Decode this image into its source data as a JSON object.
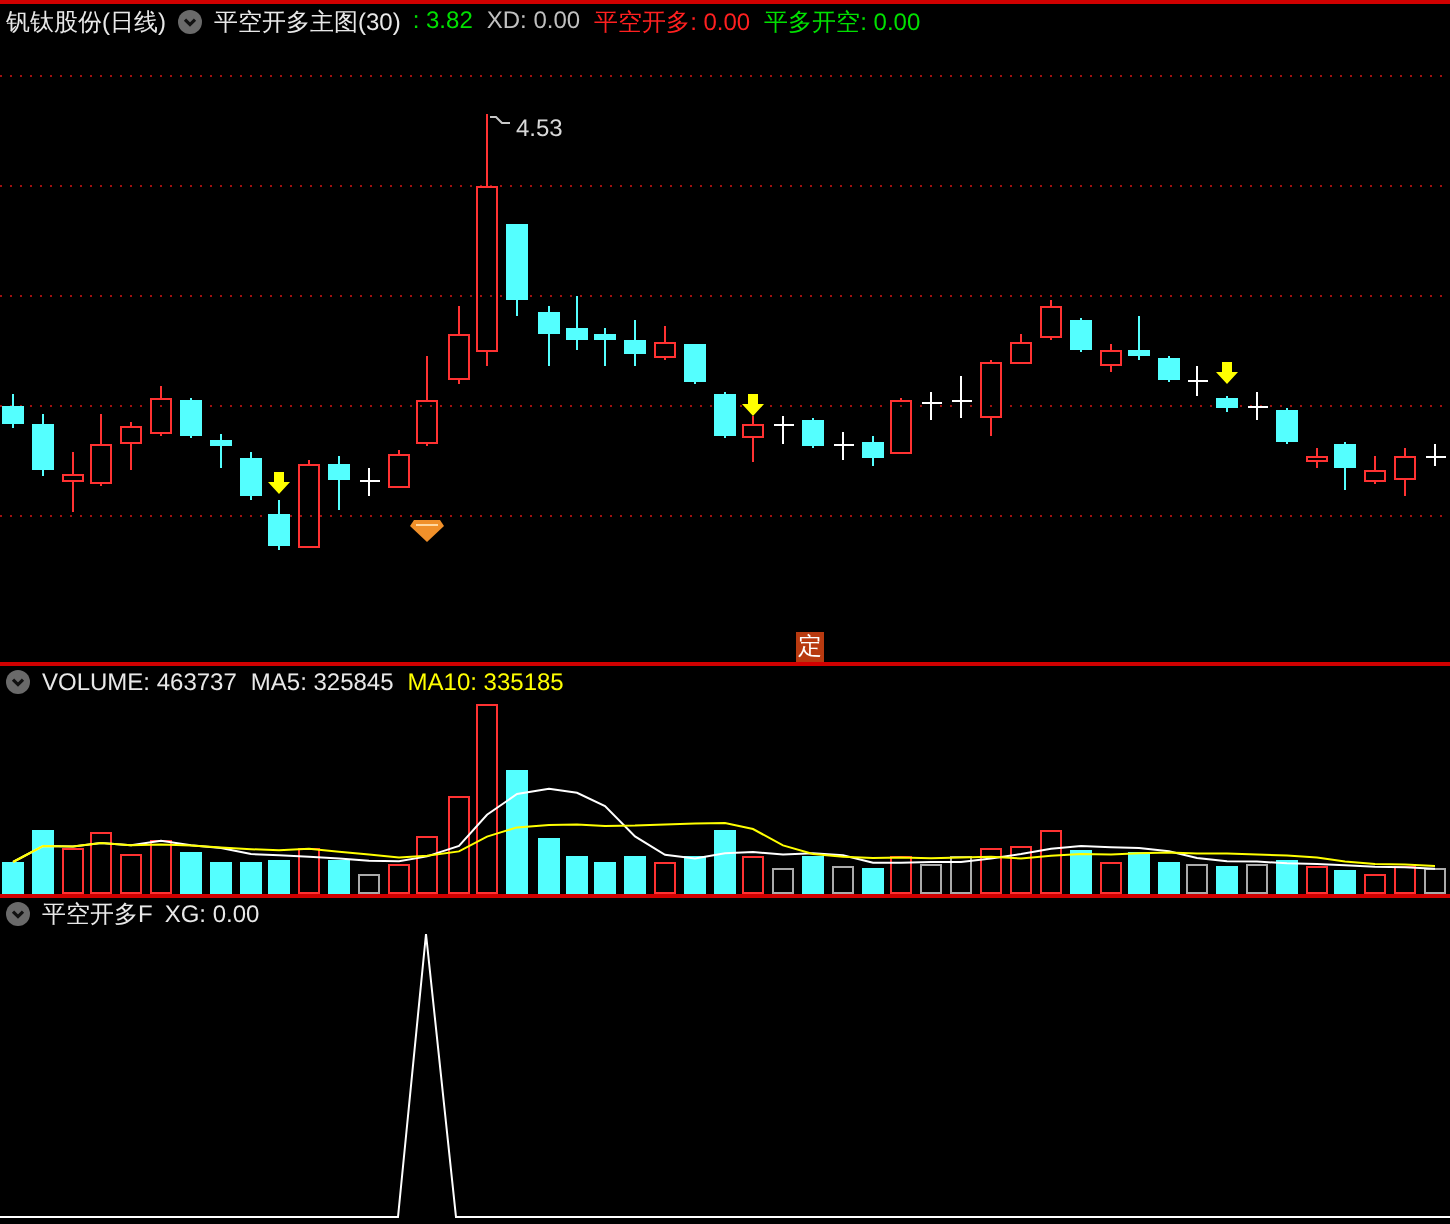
{
  "main_panel": {
    "title": "钒钛股份(日线)",
    "indicator": "平空开多主图(30)",
    "values": [
      {
        "text": ": 3.82",
        "color": "#00e000"
      },
      {
        "text": "XD: 0.00",
        "color": "#c0c0c0"
      },
      {
        "text": "平空开多: 0.00",
        "color": "#ff2020"
      },
      {
        "text": "平多开空: 0.00",
        "color": "#00e000"
      }
    ],
    "high_label": "4.53",
    "signal_badge": "定"
  },
  "volume_panel": {
    "values": [
      {
        "text": "VOLUME: 463737",
        "color": "#e8e8e8"
      },
      {
        "text": "MA5: 325845",
        "color": "#e8e8e8"
      },
      {
        "text": "MA10: 335185",
        "color": "#ffff00"
      }
    ]
  },
  "signal_panel": {
    "indicator": "平空开多F",
    "values": [
      {
        "text": "XG: 0.00",
        "color": "#e8e8e8"
      }
    ]
  }
}
